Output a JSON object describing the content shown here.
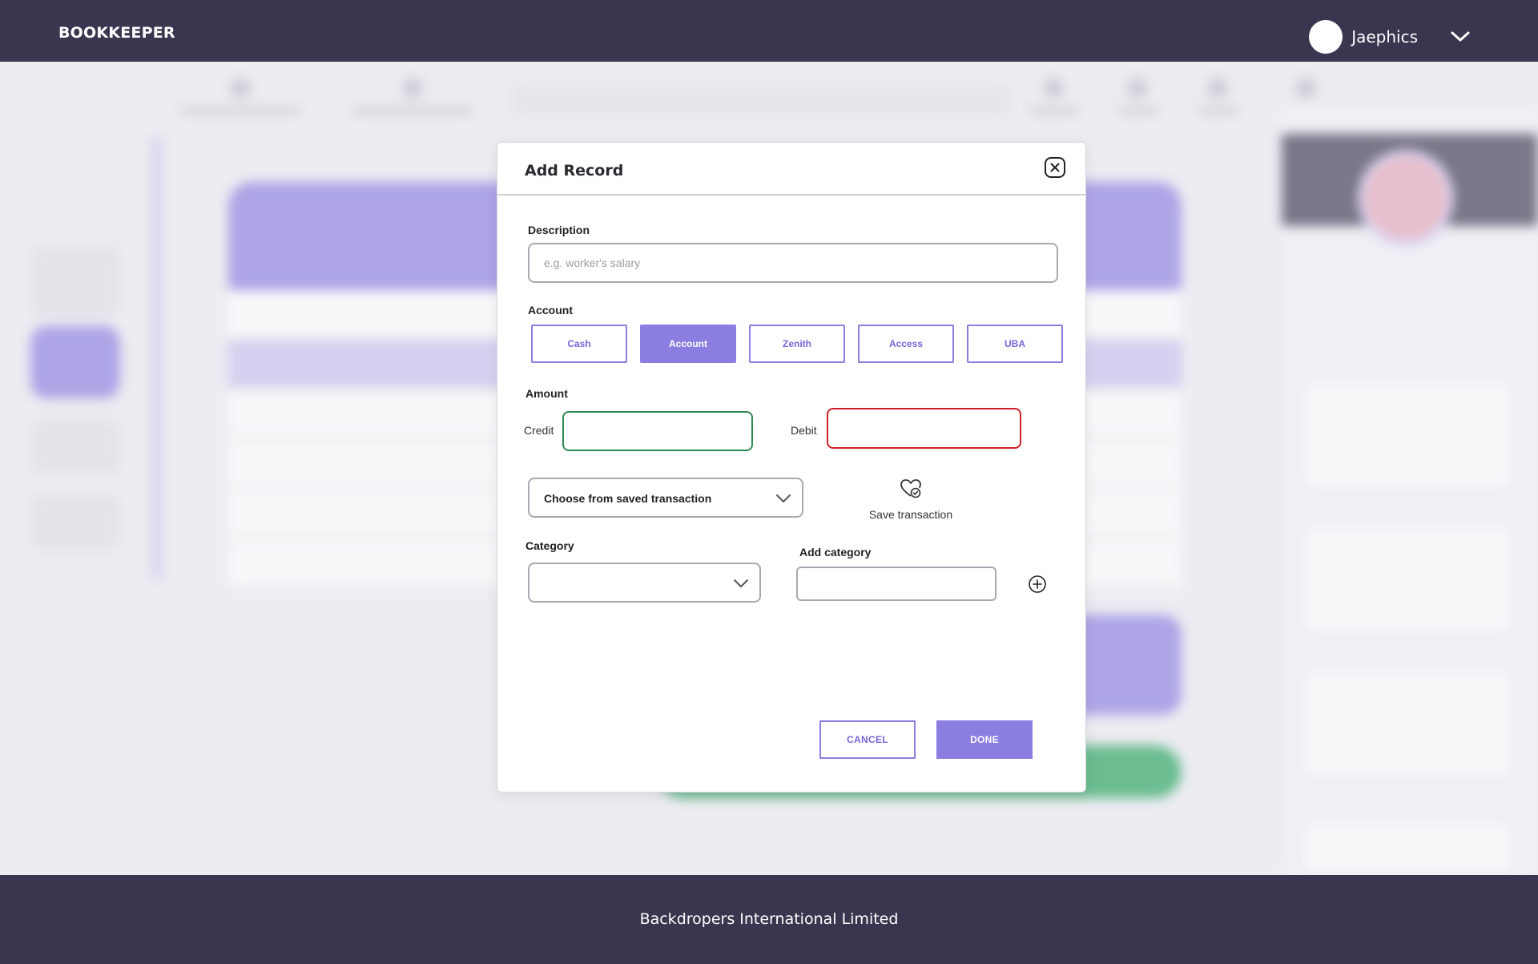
{
  "header": {
    "brand": "BOOKKEEPER",
    "username": "Jaephics"
  },
  "footer": {
    "text": "Backdropers International Limited"
  },
  "modal": {
    "title": "Add Record",
    "description": {
      "label": "Description",
      "placeholder": "e.g. worker's salary",
      "value": ""
    },
    "account": {
      "label": "Account",
      "options": [
        "Cash",
        "Account",
        "Zenith",
        "Access",
        "UBA"
      ],
      "selected": "Account"
    },
    "amount": {
      "label": "Amount",
      "credit_label": "Credit",
      "debit_label": "Debit",
      "credit_value": "",
      "debit_value": ""
    },
    "saved_transaction": {
      "select_text": "Choose from saved transaction",
      "save_label": "Save transaction"
    },
    "category": {
      "label": "Category",
      "selected": ""
    },
    "add_category": {
      "label": "Add category",
      "value": ""
    },
    "buttons": {
      "cancel": "CANCEL",
      "done": "DONE"
    }
  },
  "colors": {
    "topbar": "#3b354f",
    "accent": "#8a7ee0",
    "credit_border": "#2e8a55",
    "debit_border": "#cc1f26"
  },
  "icons": {
    "close": "close-icon",
    "user_menu": "chevron-down-icon",
    "save_transaction": "heart-check-icon",
    "add_category": "plus-circle-icon"
  }
}
